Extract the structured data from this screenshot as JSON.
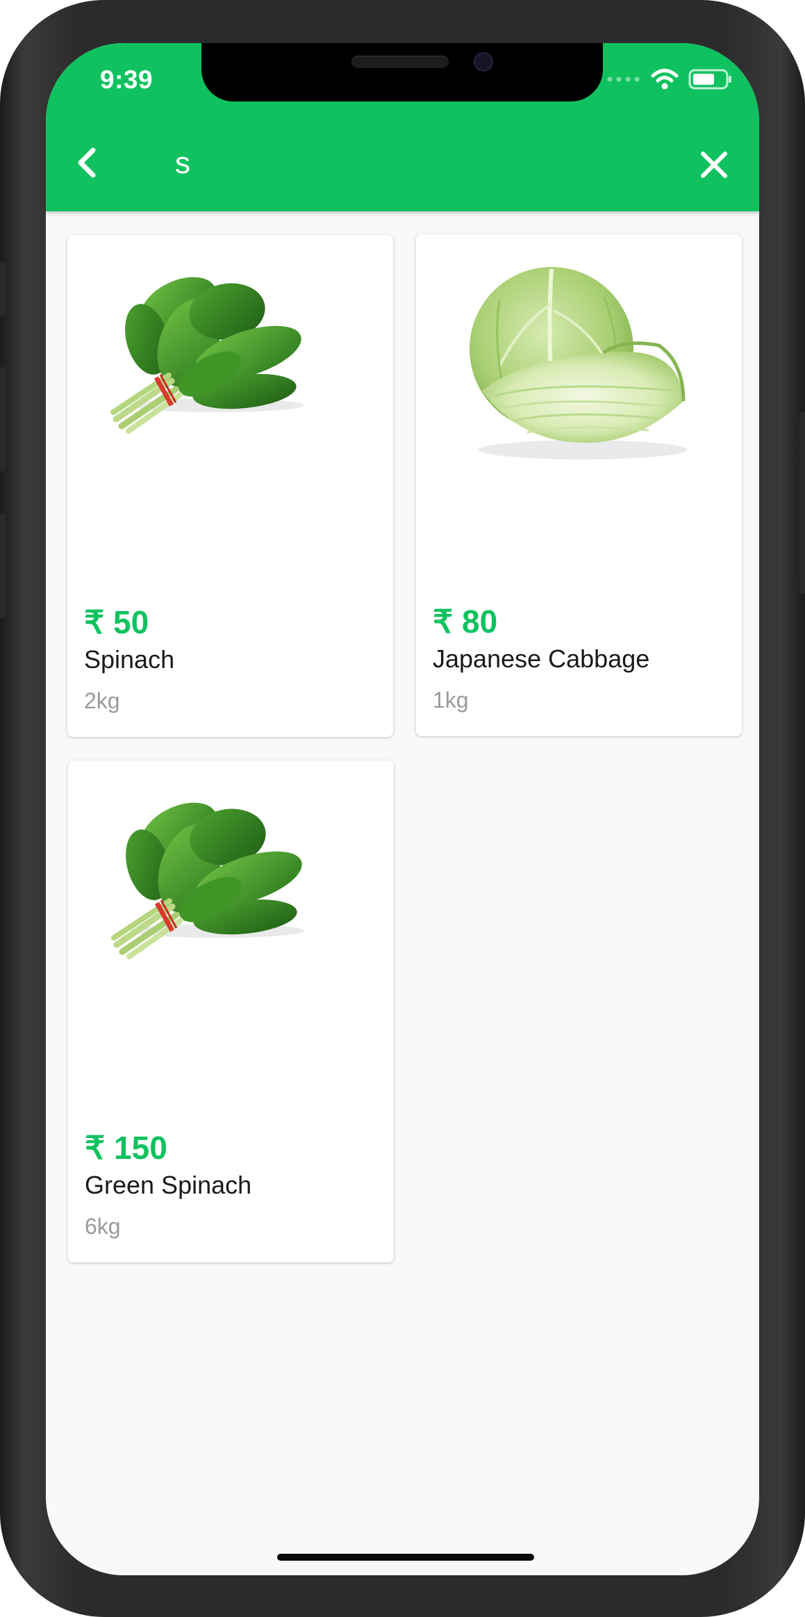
{
  "status_bar": {
    "time": "9:39"
  },
  "search": {
    "value": "s",
    "placeholder": ""
  },
  "products": [
    {
      "price": "₹ 50",
      "name": "Spinach",
      "quantity": "2kg",
      "image": "spinach-image"
    },
    {
      "price": "₹ 80",
      "name": "Japanese Cabbage",
      "quantity": "1kg",
      "image": "cabbage-image"
    },
    {
      "price": "₹ 150",
      "name": "Green Spinach",
      "quantity": "6kg",
      "image": "spinach-image"
    }
  ],
  "colors": {
    "accent": "#0fc25f",
    "background": "#f9f9f9",
    "card": "#ffffff",
    "product_name": "#1a1a1a",
    "quantity": "#9a9a9a"
  },
  "icons": [
    "back-arrow-icon",
    "close-icon",
    "wifi-icon",
    "battery-icon",
    "cellular-signal-icon"
  ]
}
